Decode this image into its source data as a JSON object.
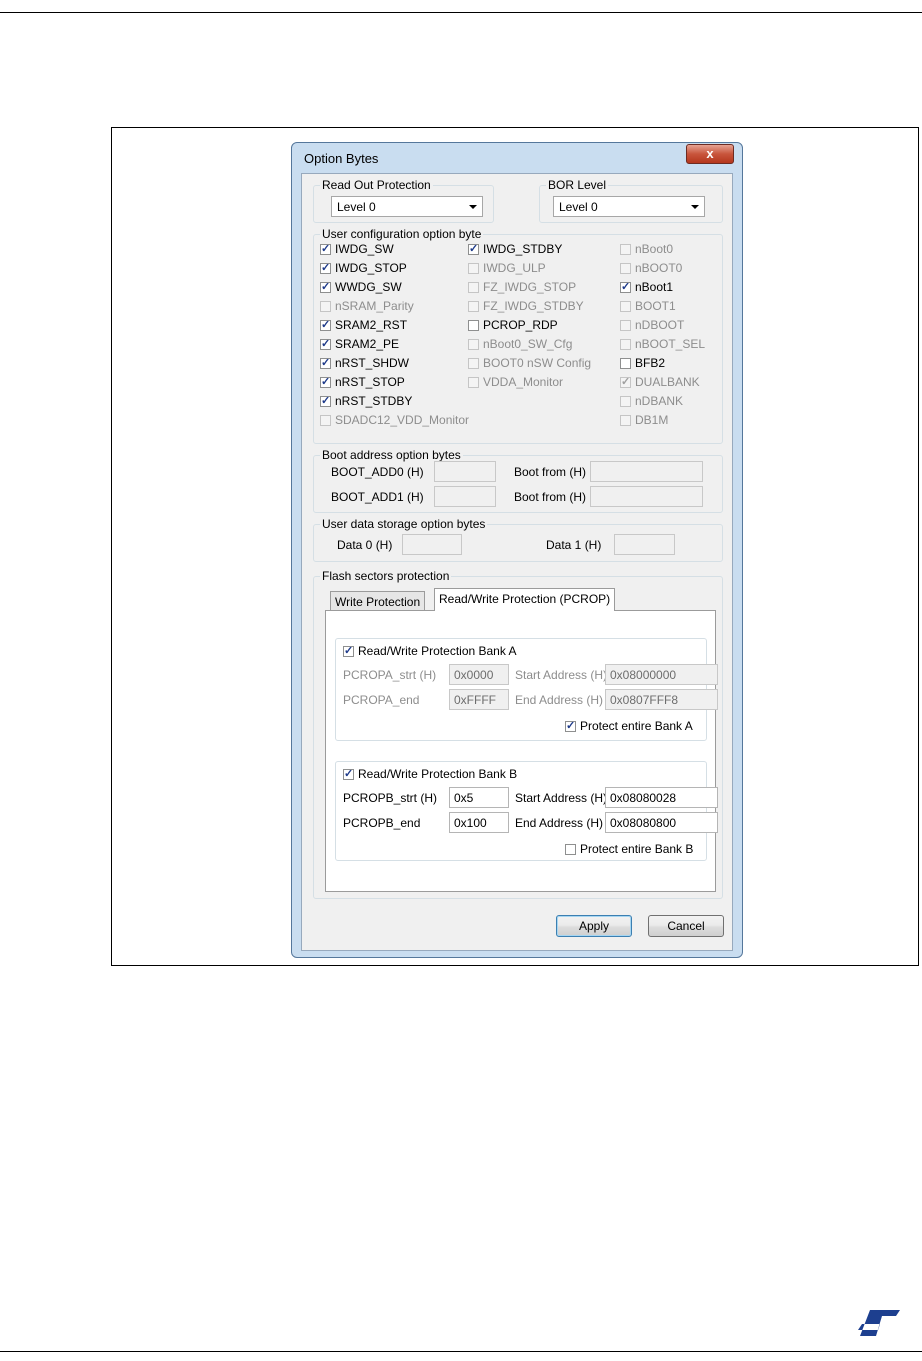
{
  "dialog": {
    "title": "Option Bytes",
    "close_label": "x"
  },
  "rop": {
    "title": "Read Out Protection",
    "value": "Level 0"
  },
  "bor": {
    "title": "BOR Level",
    "value": "Level 0"
  },
  "user_config": {
    "title": "User configuration option byte",
    "col1": [
      {
        "label": "IWDG_SW",
        "checked": true,
        "enabled": true
      },
      {
        "label": "IWDG_STOP",
        "checked": true,
        "enabled": true
      },
      {
        "label": "WWDG_SW",
        "checked": true,
        "enabled": true
      },
      {
        "label": "nSRAM_Parity",
        "checked": false,
        "enabled": false
      },
      {
        "label": "SRAM2_RST",
        "checked": true,
        "enabled": true
      },
      {
        "label": "SRAM2_PE",
        "checked": true,
        "enabled": true
      },
      {
        "label": "nRST_SHDW",
        "checked": true,
        "enabled": true
      },
      {
        "label": "nRST_STOP",
        "checked": true,
        "enabled": true
      },
      {
        "label": "nRST_STDBY",
        "checked": true,
        "enabled": true
      },
      {
        "label": "SDADC12_VDD_Monitor",
        "checked": false,
        "enabled": false
      }
    ],
    "col2": [
      {
        "label": "IWDG_STDBY",
        "checked": true,
        "enabled": true
      },
      {
        "label": "IWDG_ULP",
        "checked": false,
        "enabled": false
      },
      {
        "label": "FZ_IWDG_STOP",
        "checked": false,
        "enabled": false
      },
      {
        "label": "FZ_IWDG_STDBY",
        "checked": false,
        "enabled": false
      },
      {
        "label": "PCROP_RDP",
        "checked": false,
        "enabled": true
      },
      {
        "label": "nBoot0_SW_Cfg",
        "checked": false,
        "enabled": false
      },
      {
        "label": "BOOT0 nSW Config",
        "checked": false,
        "enabled": false
      },
      {
        "label": "VDDA_Monitor",
        "checked": false,
        "enabled": false
      }
    ],
    "col3": [
      {
        "label": "nBoot0",
        "checked": false,
        "enabled": false
      },
      {
        "label": "nBOOT0",
        "checked": false,
        "enabled": false
      },
      {
        "label": "nBoot1",
        "checked": true,
        "enabled": true
      },
      {
        "label": "BOOT1",
        "checked": false,
        "enabled": false
      },
      {
        "label": "nDBOOT",
        "checked": false,
        "enabled": false
      },
      {
        "label": "nBOOT_SEL",
        "checked": false,
        "enabled": false
      },
      {
        "label": "BFB2",
        "checked": false,
        "enabled": true
      },
      {
        "label": "DUALBANK",
        "checked": true,
        "enabled": false
      },
      {
        "label": "nDBANK",
        "checked": false,
        "enabled": false
      },
      {
        "label": "DB1M",
        "checked": false,
        "enabled": false
      }
    ]
  },
  "boot": {
    "title": "Boot address option bytes",
    "add0_label": "BOOT_ADD0 (H)",
    "add1_label": "BOOT_ADD1 (H)",
    "from_label": "Boot from (H)",
    "add0_value": "",
    "add1_value": "",
    "from0_value": "",
    "from1_value": ""
  },
  "data_storage": {
    "title": "User data storage option bytes",
    "data0_label": "Data 0 (H)",
    "data1_label": "Data 1 (H)",
    "data0_value": "",
    "data1_value": ""
  },
  "flash": {
    "title": "Flash sectors protection",
    "tabs": [
      "Write Protection",
      "Read/Write Protection (PCROP)"
    ],
    "bankA": {
      "enable_label": "Read/Write Protection Bank A",
      "enabled": true,
      "strt_label": "PCROPA_strt  (H)",
      "strt_value": "0x0000",
      "end_label": "PCROPA_end",
      "end_value": "0xFFFF",
      "start_addr_label": "Start Address (H)",
      "start_addr_value": "0x08000000",
      "end_addr_label": "End Address  (H)",
      "end_addr_value": "0x0807FFF8",
      "protect_label": "Protect entire Bank A",
      "protect_checked": true
    },
    "bankB": {
      "enable_label": "Read/Write Protection Bank B",
      "enabled": true,
      "strt_label": "PCROPB_strt  (H)",
      "strt_value": "0x5",
      "end_label": "PCROPB_end",
      "end_value": "0x100",
      "start_addr_label": "Start Address (H)",
      "start_addr_value": "0x08080028",
      "end_addr_label": "End Address  (H)",
      "end_addr_value": "0x08080800",
      "protect_label": "Protect entire Bank B",
      "protect_checked": false
    }
  },
  "buttons": {
    "apply": "Apply",
    "cancel": "Cancel"
  },
  "colors": {
    "logo": "#1d3f8f",
    "check": "#1e3a8a"
  }
}
